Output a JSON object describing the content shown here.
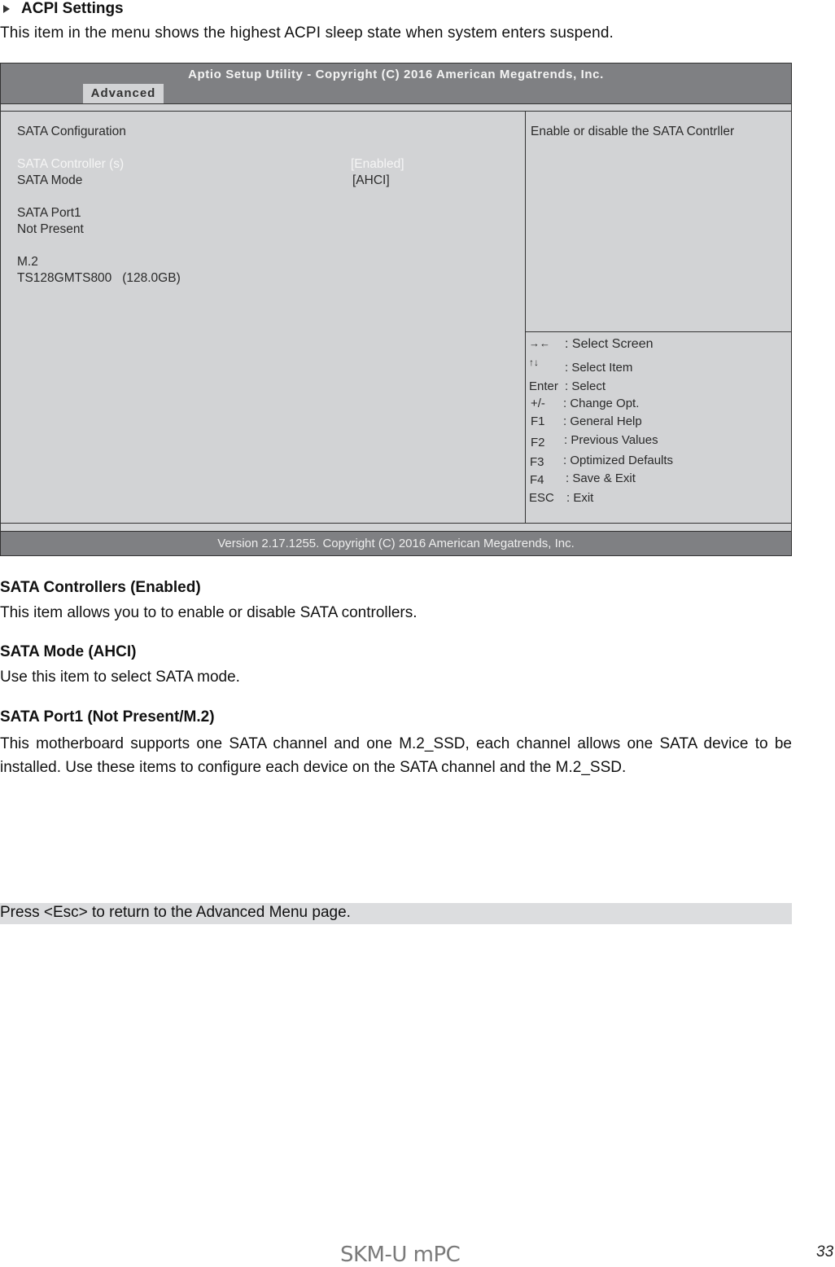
{
  "section": {
    "title": "ACPI Settings",
    "description": "This item in the menu shows the highest ACPI sleep state when system enters suspend."
  },
  "bios": {
    "title": "Aptio Setup Utility - Copyright (C) 2016 American Megatrends, Inc.",
    "active_tab": "Advanced",
    "left_panel": {
      "heading": "SATA Configuration",
      "items": [
        {
          "label": "SATA Controller (s)",
          "value": "[Enabled]",
          "selected": true
        },
        {
          "label": "SATA Mode",
          "value": "[AHCI]",
          "selected": false
        }
      ],
      "port1_label": "SATA Port1",
      "port1_status": "Not Present",
      "m2_label": "M.2",
      "m2_device": "TS128GMTS800   (128.0GB)"
    },
    "help_text": "Enable or disable the SATA Contrller",
    "key_help": [
      {
        "key": "→←",
        "action": ": Select Screen"
      },
      {
        "key": "↑↓",
        "action": ": Select Item"
      },
      {
        "key": "Enter",
        "action": ": Select"
      },
      {
        "key": "+/-",
        "action": ": Change Opt."
      },
      {
        "key": "F1",
        "action": ": General Help"
      },
      {
        "key": "F2",
        "action": ": Previous Values"
      },
      {
        "key": "F3",
        "action": ": Optimized Defaults"
      },
      {
        "key": "F4",
        "action": ": Save & Exit"
      },
      {
        "key": "ESC",
        "action": ": Exit"
      }
    ],
    "footer": "Version 2.17.1255. Copyright (C) 2016 American Megatrends, Inc."
  },
  "descriptions": [
    {
      "heading": "SATA Controllers (Enabled)",
      "text": "This item allows you to to enable or disable SATA controllers."
    },
    {
      "heading": "SATA Mode (AHCI)",
      "text": "Use this item to select SATA mode."
    },
    {
      "heading": "SATA Port1 (Not Present/M.2)",
      "text": "This motherboard supports one SATA channel and one M.2_SSD, each channel allows one SATA device to be installed. Use these items to configure each device on the SATA channel and the M.2_SSD."
    }
  ],
  "esc_note": "Press <Esc> to return to the Advanced Menu page.",
  "page_footer": {
    "product": "SKM-U mPC",
    "page_number": "33"
  }
}
